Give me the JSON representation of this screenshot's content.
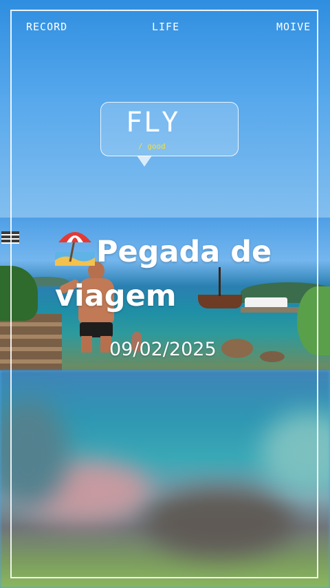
{
  "header": {
    "left_label": "RECORD",
    "center_label": "LIFE",
    "right_label": "MOIVE"
  },
  "bubble": {
    "title": "FLY",
    "subtitle": "/ good"
  },
  "headline": {
    "line1": "Pegada de",
    "line2": "viagem",
    "icon": "beach-umbrella-icon"
  },
  "date": "09/02/2025"
}
